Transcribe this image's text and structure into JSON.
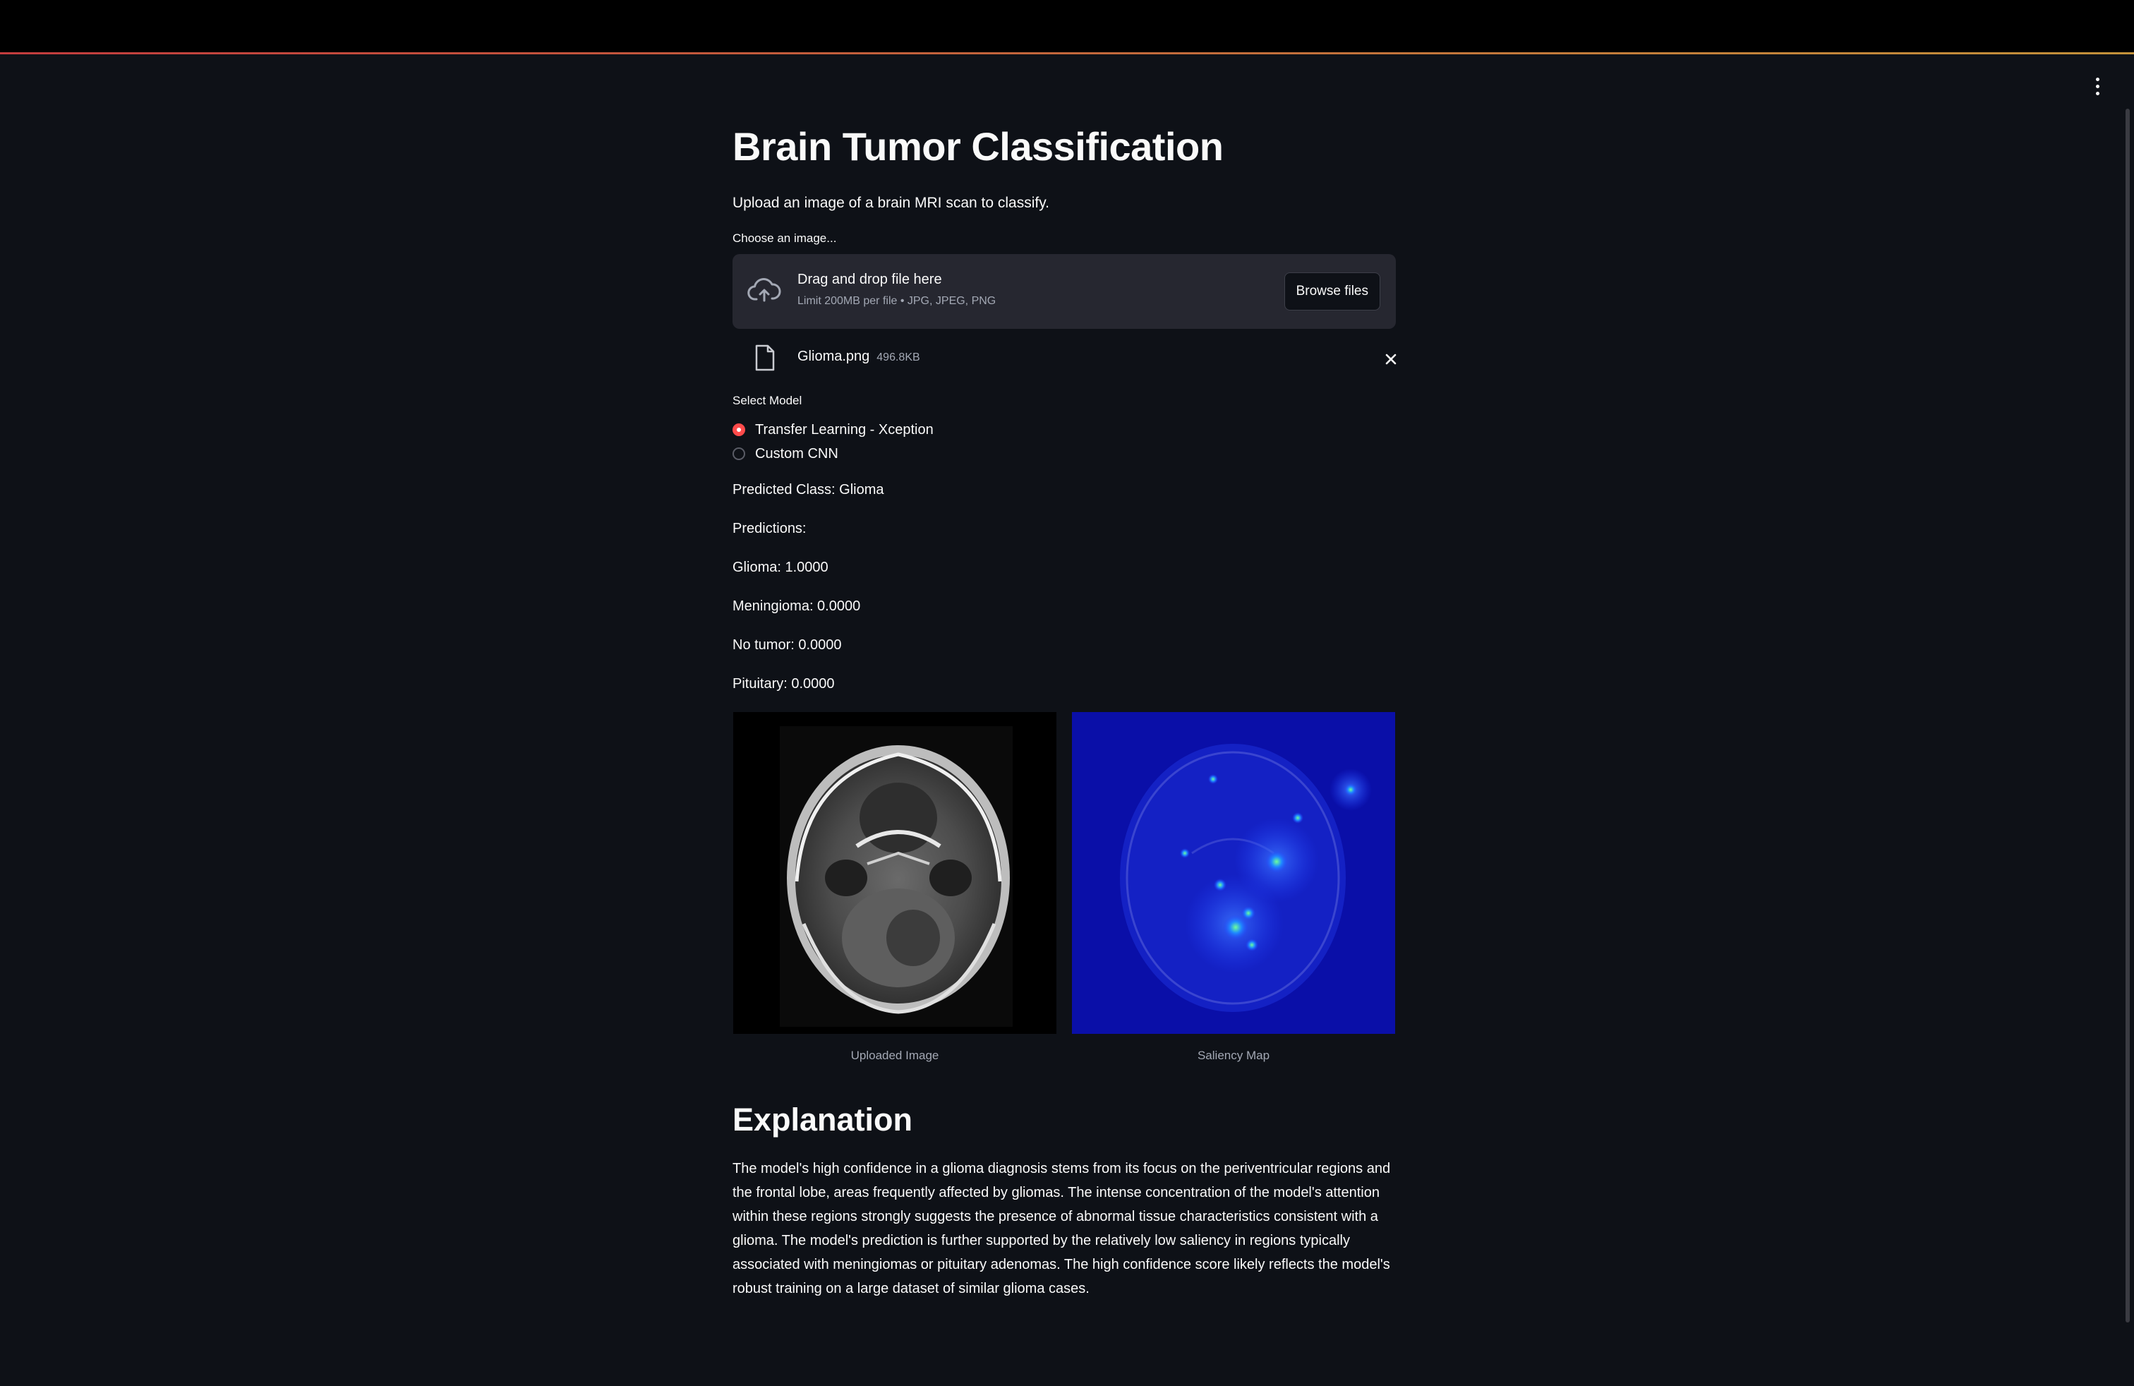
{
  "app": {
    "title": "Brain Tumor Classification",
    "subtitle": "Upload an image of a brain MRI scan to classify.",
    "accent_color": "#ff4b4b"
  },
  "uploader": {
    "label": "Choose an image...",
    "drop_text": "Drag and drop file here",
    "limit_text": "Limit 200MB per file • JPG, JPEG, PNG",
    "browse_label": "Browse files",
    "icon": "cloud-upload-icon"
  },
  "uploaded_file": {
    "name": "Glioma.png",
    "size": "496.8KB",
    "icon": "file-icon"
  },
  "model_select": {
    "label": "Select Model",
    "options": [
      {
        "label": "Transfer Learning - Xception",
        "selected": true
      },
      {
        "label": "Custom CNN",
        "selected": false
      }
    ]
  },
  "results": {
    "predicted_class": "Predicted Class: Glioma",
    "predictions_header": "Predictions:",
    "predictions": [
      "Glioma: 1.0000",
      "Meningioma: 0.0000",
      "No tumor: 0.0000",
      "Pituitary: 0.0000"
    ]
  },
  "images": {
    "left_caption": "Uploaded Image",
    "right_caption": "Saliency Map"
  },
  "explanation": {
    "heading": "Explanation",
    "text": "The model's high confidence in a glioma diagnosis stems from its focus on the periventricular regions and the frontal lobe, areas frequently affected by gliomas. The intense concentration of the model's attention within these regions strongly suggests the presence of abnormal tissue characteristics consistent with a glioma. The model's prediction is further supported by the relatively low saliency in regions typically associated with meningiomas or pituitary adenomas. The high confidence score likely reflects the model's robust training on a large dataset of similar glioma cases."
  }
}
